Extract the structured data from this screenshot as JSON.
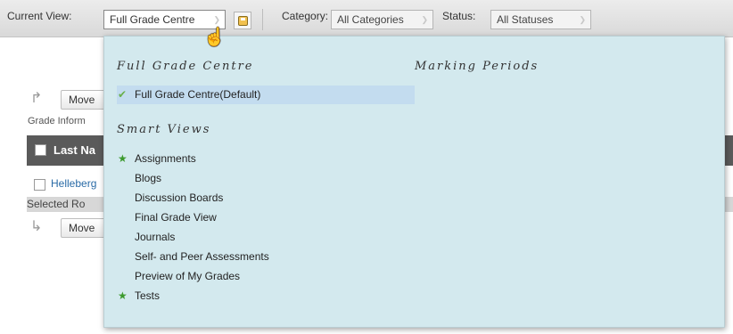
{
  "toolbar": {
    "current_view_label": "Current View:",
    "current_view_value": "Full Grade Centre",
    "category_label": "Category:",
    "category_value": "All Categories",
    "status_label": "Status:",
    "status_value": "All Statuses"
  },
  "background": {
    "move_label_top": "Move",
    "grade_info": "Grade Inform",
    "grid_header_label": "Last Na",
    "row_link": "Helleberg",
    "selected_rows": "Selected Ro",
    "move_label_bottom": "Move"
  },
  "menu": {
    "section_full": "Full Grade Centre",
    "section_marking": "Marking Periods",
    "default_item": "Full Grade Centre(Default)",
    "section_smart": "Smart Views",
    "smart_items": [
      {
        "label": "Assignments",
        "icon": "star-icon"
      },
      {
        "label": "Blogs",
        "icon": ""
      },
      {
        "label": "Discussion Boards",
        "icon": ""
      },
      {
        "label": "Final Grade View",
        "icon": ""
      },
      {
        "label": "Journals",
        "icon": ""
      },
      {
        "label": "Self- and Peer Assessments",
        "icon": ""
      },
      {
        "label": "Preview of My Grades",
        "icon": ""
      },
      {
        "label": "Tests",
        "icon": "star-icon"
      }
    ]
  },
  "colors": {
    "menu_bg": "#d3e9ee",
    "selected_item_bg": "#c3dcef",
    "grid_header_bg": "#5a5a5a",
    "link": "#2a6ba6",
    "star": "#3c9a2e"
  }
}
